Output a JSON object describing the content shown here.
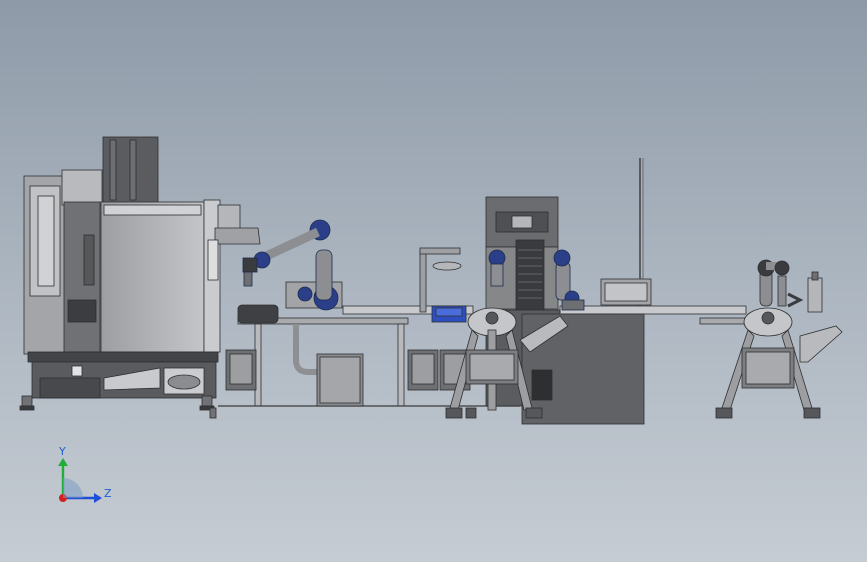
{
  "viewport": {
    "background_top": "#8e9aa8",
    "background_bottom": "#c6ccd3"
  },
  "triad": {
    "y_label": "Y",
    "z_label": "Z",
    "y_color": "#1fae3a",
    "z_color": "#1f4fd6",
    "x_color": "#d02020"
  },
  "colors": {
    "machine_grey": "#8d8f92",
    "machine_light": "#b7b9bc",
    "machine_dark": "#4b4d50",
    "robot_blue": "#2a3f87",
    "bin_blue": "#2e4fbf"
  },
  "assemblies": [
    {
      "name": "cnc-machine"
    },
    {
      "name": "robot-arm-left"
    },
    {
      "name": "conveyor-table"
    },
    {
      "name": "tower-station"
    },
    {
      "name": "robot-arm-right"
    },
    {
      "name": "tripod-stand-center"
    },
    {
      "name": "tripod-stand-right"
    }
  ]
}
